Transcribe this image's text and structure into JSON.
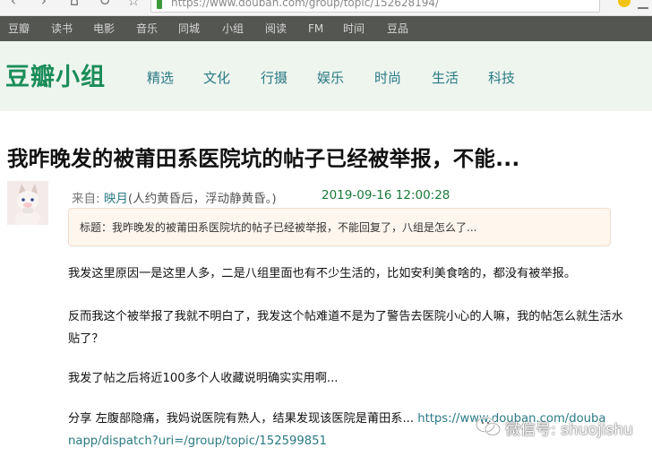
{
  "browser": {
    "url": "https://www.douban.com/group/topic/152628194/"
  },
  "global_nav": {
    "items": [
      "豆瓣",
      "读书",
      "电影",
      "音乐",
      "同城",
      "小组",
      "阅读",
      "FM",
      "时间",
      "豆品"
    ]
  },
  "group_header": {
    "brand": "豆瓣小组",
    "categories": [
      "精选",
      "文化",
      "行摄",
      "娱乐",
      "时尚",
      "生活",
      "科技"
    ]
  },
  "post": {
    "title": "我昨晚发的被莆田系医院坑的帖子已经被举报，不能...",
    "from_label": "来自: ",
    "author": "映月",
    "signature": "(人约黄昏后，浮动静黄昏。)",
    "time": "2019-09-16 12:00:28",
    "topic_box": "标题：我昨晚发的被莆田系医院坑的帖子已经被举报，不能回复了，八组是怎么了...",
    "paragraphs": [
      "我发这里原因一是这里人多，二是八组里面也有不少生活的，比如安利美食啥的，都没有被举报。",
      "反而我这个被举报了我就不明白了，我发这个帖难道不是为了警告去医院小心的人嘛，我的帖怎么就生活水贴了？",
      "我发了帖之后将近100多个人收藏说明确实实用啊..."
    ],
    "share_prefix": "分享 ",
    "share_text": "左腹部隐痛，我妈说医院有熟人，结果发现该医院是莆田系... ",
    "share_link": "https://www.douban.com/doubanapp/dispatch?uri=/group/topic/152599851"
  },
  "watermark": {
    "text": "微信号: shuojishu"
  },
  "colors": {
    "brand_green": "#1b8d59",
    "nav_bg": "#545652",
    "link_teal": "#2b7a84",
    "time_green": "#1b7a3a"
  }
}
